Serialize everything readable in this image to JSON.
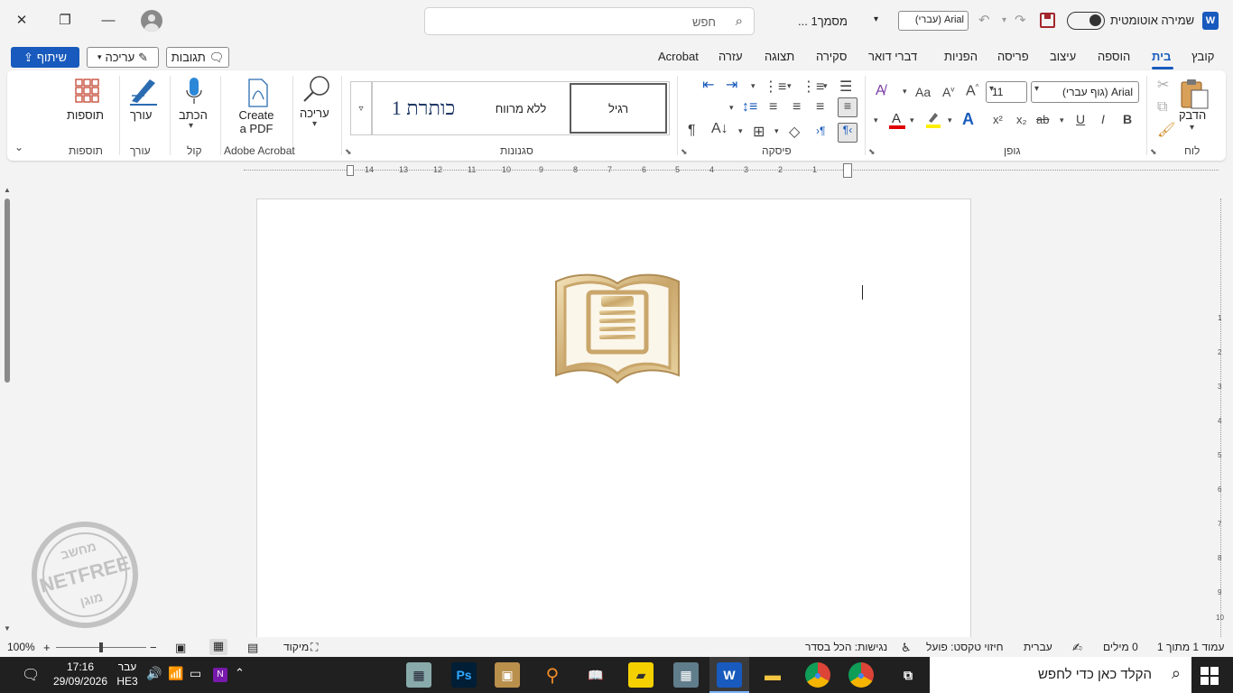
{
  "titlebar": {
    "search_placeholder": "חפש",
    "doc_title": "מסמך1 ...",
    "font_quick": "Arial (עברי)",
    "autosave_label": "שמירה אוטומטית",
    "app_icon": "W"
  },
  "menu": {
    "share": "שיתוף",
    "editing": "עריכה",
    "comments": "תגובות",
    "tabs": [
      "קובץ",
      "בית",
      "הוספה",
      "עיצוב",
      "פריסה",
      "הפניות",
      "דברי דואר",
      "סקירה",
      "תצוגה",
      "עזרה",
      "Acrobat"
    ]
  },
  "ribbon": {
    "clipboard": {
      "paste": "הדבק",
      "group": "לוח"
    },
    "font": {
      "name": "Arial (גוף עברי)",
      "size": "11",
      "group": "גופן",
      "bold": "B",
      "italic": "I",
      "underline": "U",
      "strike": "ab",
      "sub": "x₂",
      "sup": "x²",
      "aa_big": "A",
      "aa_small": "A",
      "case": "Aa"
    },
    "paragraph": {
      "group": "פיסקה"
    },
    "styles": {
      "group": "סגנונות",
      "items": [
        "רגיל",
        "ללא מרווח",
        "כותרת 1"
      ]
    },
    "editing": {
      "label": "עריכה",
      "group": ""
    },
    "acrobat": {
      "label": "Create\na PDF",
      "line1": "Create",
      "line2": "a PDF",
      "group": "Adobe Acrobat"
    },
    "voice": {
      "label": "הכתב",
      "group": "קול"
    },
    "editor": {
      "label": "עורך",
      "group": "עורך"
    },
    "addins": {
      "label": "תוספות",
      "group": "תוספות"
    }
  },
  "ruler": {
    "h_ticks": [
      "14",
      "13",
      "12",
      "11",
      "10",
      "9",
      "8",
      "7",
      "6",
      "5",
      "4",
      "3",
      "2",
      "1"
    ],
    "v_ticks": [
      "1",
      "2",
      "3",
      "4",
      "5",
      "6",
      "7",
      "8",
      "9",
      "10"
    ]
  },
  "statusbar": {
    "page": "עמוד 1 מתוך 1",
    "words": "0 מילים",
    "language": "עברית",
    "prediction": "חיזוי טקסט: פועל",
    "accessibility": "נגישות: הכל בסדר",
    "focus": "מיקוד",
    "zoom": "100%"
  },
  "watermark": {
    "top": "מחשב",
    "middle": "NETFREE",
    "bottom": "מוגן"
  },
  "taskbar": {
    "search": "הקלד כאן כדי לחפש",
    "time": "17:16",
    "date": "29/09/2026",
    "lang_top": "עבר",
    "lang_bottom": "HE3",
    "apps": [
      "Ps"
    ]
  },
  "colors": {
    "accent": "#185abd",
    "font_red": "#e00000",
    "highlight": "#ffee00"
  }
}
